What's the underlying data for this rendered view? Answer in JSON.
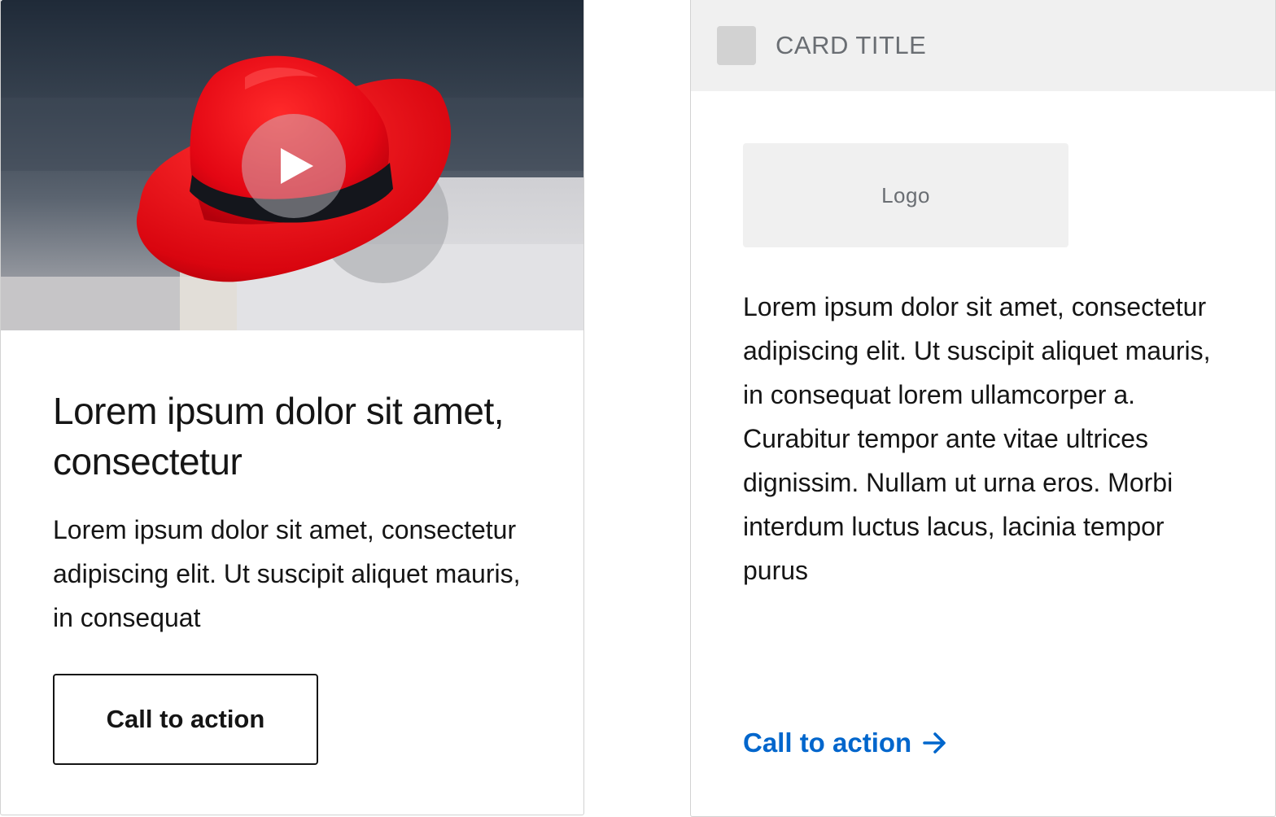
{
  "media_card": {
    "media": {
      "description_icon": "play-icon"
    },
    "heading": "Lorem ipsum dolor sit amet, consectetur",
    "body": "Lorem ipsum dolor sit amet, consectetur adipiscing elit. Ut suscipit aliquet mauris, in consequat",
    "cta_label": "Call to action"
  },
  "logo_card": {
    "header": {
      "icon": "placeholder-square-icon",
      "title": "CARD TITLE"
    },
    "logo_label": "Logo",
    "body": "Lorem ipsum dolor sit amet, consectetur adipiscing elit. Ut suscipit aliquet mauris, in consequat lorem ullamcorper a. Curabitur tempor ante vitae ultrices dignissim. Nullam ut urna eros. Morbi interdum luctus lacus, lacinia tempor purus",
    "cta_label": "Call to action",
    "cta_icon": "arrow-right-icon"
  },
  "colors": {
    "link_blue": "#0066cc",
    "text": "#151515",
    "muted_text": "#6a6e73",
    "header_bg": "#f0f0f0",
    "border": "#d2d2d2",
    "hat_red": "#e30613"
  }
}
